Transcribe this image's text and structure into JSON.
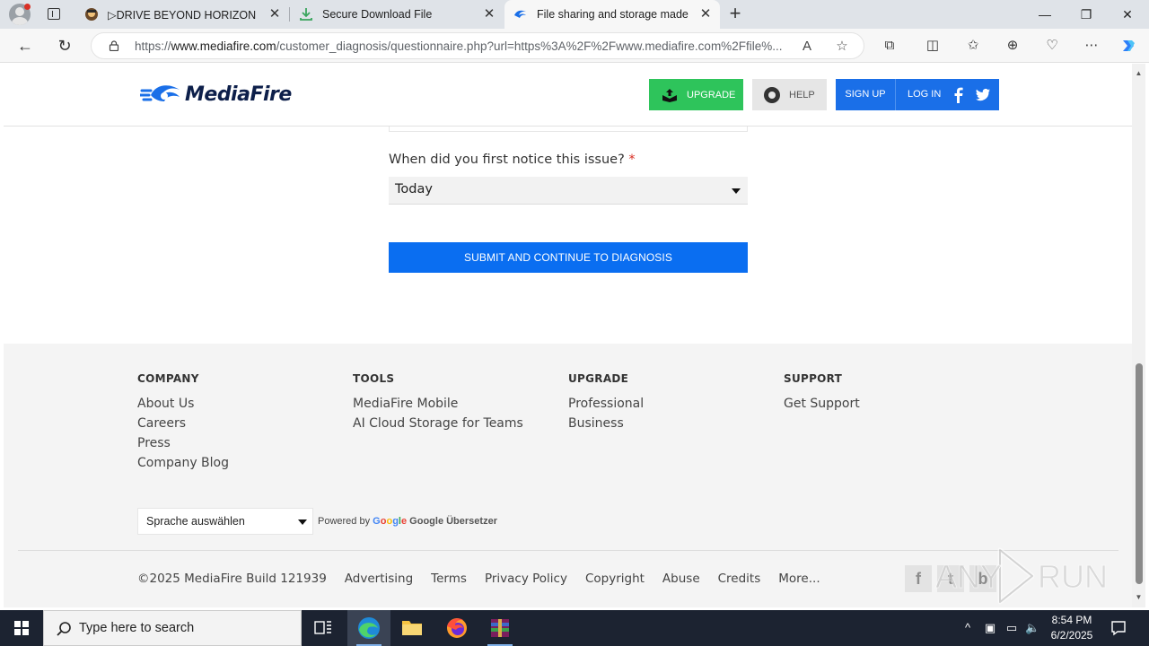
{
  "browser": {
    "tabs": [
      {
        "title": "▷DRIVE BEYOND HORIZON Build",
        "active": false
      },
      {
        "title": "Secure Download File",
        "active": false
      },
      {
        "title": "File sharing and storage made simple",
        "active": true
      }
    ],
    "url_prefix": "https://",
    "url_domain": "www.mediafire.com",
    "url_rest": "/customer_diagnosis/questionnaire.php?url=https%3A%2F%2Fwww.mediafire.com%2Ffile%..."
  },
  "header": {
    "logo_text": "MediaFire",
    "upgrade_label": "UPGRADE",
    "help_label": "HELP",
    "signup_label": "SIGN UP",
    "login_label": "LOG IN"
  },
  "form": {
    "question_label": "When did you first notice this issue?",
    "required_mark": "*",
    "answer_value": "Today",
    "submit_label": "SUBMIT AND CONTINUE TO DIAGNOSIS"
  },
  "footer": {
    "columns": [
      {
        "heading": "COMPANY",
        "links": [
          "About Us",
          "Careers",
          "Press",
          "Company Blog"
        ]
      },
      {
        "heading": "TOOLS",
        "links": [
          "MediaFire Mobile",
          "AI Cloud Storage for Teams"
        ]
      },
      {
        "heading": "UPGRADE",
        "links": [
          "Professional",
          "Business"
        ]
      },
      {
        "heading": "SUPPORT",
        "links": [
          "Get Support"
        ]
      }
    ],
    "language_select": "Sprache auswählen",
    "powered_by": "Powered by",
    "translator": "Google Übersetzer",
    "google_word": "Google",
    "copyright": "©2025 MediaFire Build 121939",
    "bottom_links": [
      "Advertising",
      "Terms",
      "Privacy Policy",
      "Copyright",
      "Abuse",
      "Credits",
      "More..."
    ],
    "social_icons": [
      "facebook-icon",
      "twitter-icon",
      "blogger-icon"
    ]
  },
  "watermark": "ANY RUN",
  "taskbar": {
    "search_placeholder": "Type here to search",
    "time": "8:54 PM",
    "date": "6/2/2025"
  },
  "colors": {
    "upgrade_green": "#2ec45b",
    "auth_blue": "#1a6fe8",
    "submit_blue": "#0a6ef1",
    "footer_bg": "#f4f4f4"
  }
}
